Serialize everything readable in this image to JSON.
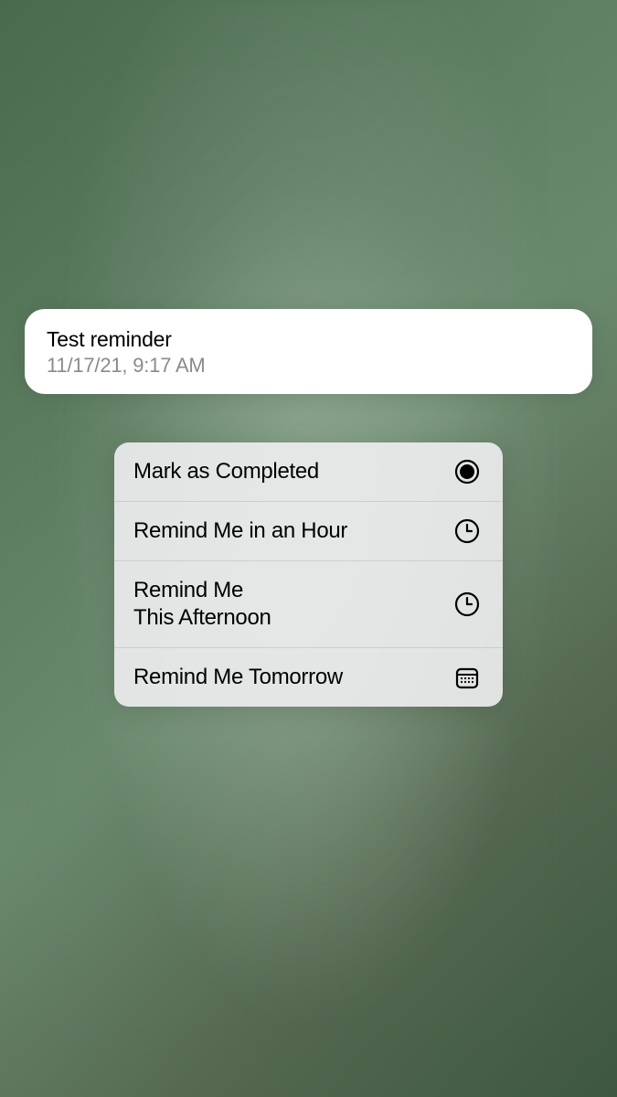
{
  "notification": {
    "title": "Test reminder",
    "subtitle": "11/17/21, 9:17 AM"
  },
  "actions": {
    "complete": {
      "label": "Mark as Completed"
    },
    "hour": {
      "label": "Remind Me in an Hour"
    },
    "afternoon": {
      "label": "Remind Me\nThis Afternoon"
    },
    "tomorrow": {
      "label": "Remind Me Tomorrow"
    }
  }
}
